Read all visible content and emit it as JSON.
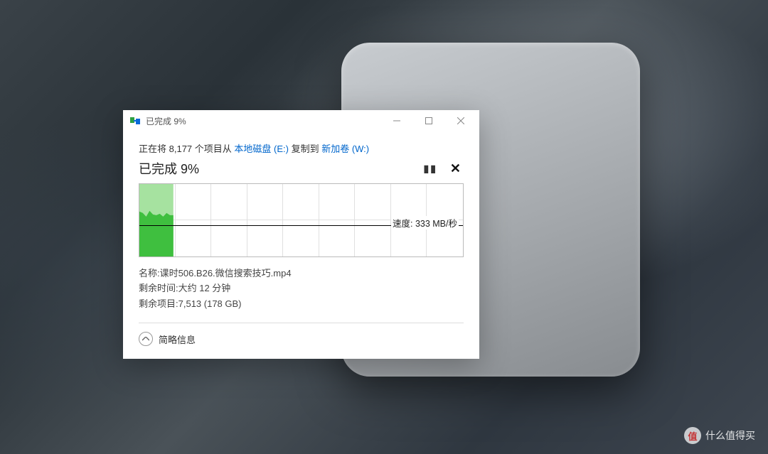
{
  "titlebar": {
    "title": "已完成 9%"
  },
  "copy": {
    "prefix": "正在将 ",
    "count": "8,177",
    "items_from": " 个项目从 ",
    "source": "本地磁盘 (E:)",
    "copy_to": " 复制到 ",
    "dest": "新加卷 (W:)"
  },
  "progress": {
    "label": "已完成 9%"
  },
  "chart_data": {
    "type": "area",
    "x_extent_pct": 10.5,
    "speed_line_pct": 57,
    "series": [
      {
        "name": "max",
        "values_pct": [
          100,
          100,
          100,
          100,
          100,
          100,
          100,
          100,
          100,
          100,
          100
        ],
        "color": "#a6e2a0"
      },
      {
        "name": "current",
        "values_pct": [
          62,
          60,
          55,
          63,
          58,
          57,
          59,
          55,
          60,
          57,
          57
        ],
        "color": "#3fbf3f"
      }
    ],
    "speed_label": "速度: 333 MB/秒",
    "grid": {
      "cols": 9,
      "rows": 2
    }
  },
  "details": {
    "name_label": "名称: ",
    "name_value": "课时506.B26.微信搜索技巧.mp4",
    "time_label": "剩余时间: ",
    "time_value": "大约 12 分钟",
    "items_label": "剩余项目: ",
    "items_value": "7,513 (178 GB)"
  },
  "toggle": {
    "label": "简略信息"
  },
  "watermark": {
    "badge": "值",
    "text": "什么值得买"
  }
}
